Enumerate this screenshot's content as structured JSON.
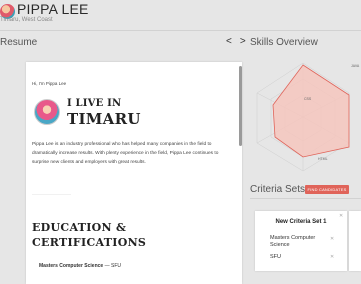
{
  "header": {
    "name": "PIPPA LEE",
    "location": "Timaru, West Coast"
  },
  "resume": {
    "section_title": "Resume",
    "nav_prev": "<",
    "nav_next": ">",
    "greeting": "Hi, I'm Pippa Lee",
    "live_in": "I LIVE IN",
    "city": "TIMARU",
    "bio": "Pippa Lee is an industry professional who has helped many companies in the field to dramatically increase results. With plenty experience in the field, Pippa Lee continues to surprise new clients and employers with great results.",
    "edu_title": "EDUCATION & CERTIFICATIONS",
    "edu_item_degree": "Masters Computer Science",
    "edu_item_sep": " — ",
    "edu_item_school": "SFU"
  },
  "skills": {
    "section_title": "Skills Overview",
    "labels": [
      "CSS",
      "HTML",
      "JAVA"
    ],
    "colors": {
      "fill": "#f4c6bd",
      "stroke": "#e0645a",
      "grid": "#cfcfcf"
    }
  },
  "criteria": {
    "section_title": "Criteria Sets",
    "find_button": "FIND CANDIDATES",
    "cards": [
      {
        "title": "New Criteria Set 1",
        "items": [
          "Masters Computer Science",
          "SFU"
        ]
      }
    ]
  }
}
